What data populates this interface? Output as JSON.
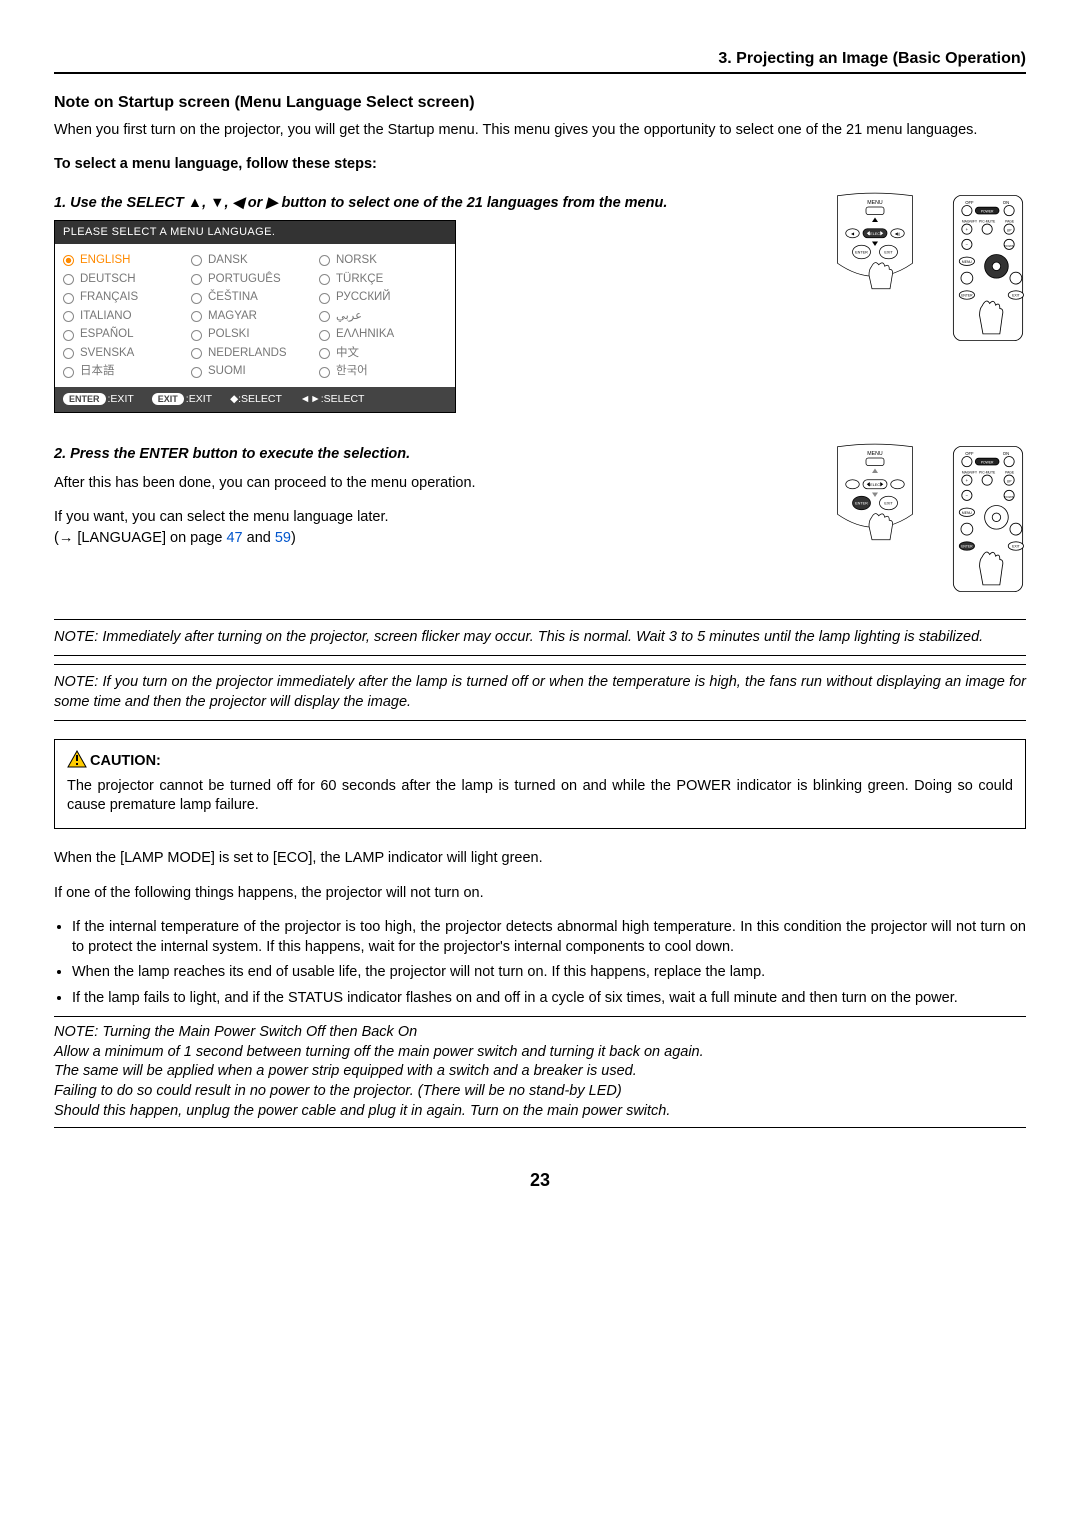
{
  "chapter_header": "3. Projecting an Image (Basic Operation)",
  "section_title": "Note on Startup screen (Menu Language Select screen)",
  "intro": "When you first turn on the projector, you will get the Startup menu. This menu gives you the opportunity to select one of the 21 menu languages.",
  "sub_bold": "To select a menu language, follow these steps:",
  "step1_label": "1.  Use the SELECT ▲, ▼, ◀ or ▶ button to select one of the 21 languages from the menu.",
  "osd": {
    "title": "PLEASE SELECT A MENU LANGUAGE.",
    "cols": [
      [
        "ENGLISH",
        "DEUTSCH",
        "FRANÇAIS",
        "ITALIANO",
        "ESPAÑOL",
        "SVENSKA",
        "日本語"
      ],
      [
        "DANSK",
        "PORTUGUÊS",
        "ČEŠTINA",
        "MAGYAR",
        "POLSKI",
        "NEDERLANDS",
        "SUOMI"
      ],
      [
        "NORSK",
        "TÜRKÇE",
        "РУССКИЙ",
        "عربي",
        "ΕΛΛΗΝΙΚΑ",
        "中文",
        "한국어"
      ]
    ],
    "footer": [
      "ENTER :EXIT",
      "EXIT :EXIT",
      "◆:SELECT",
      "◄►:SELECT"
    ],
    "footer_pills": [
      "ENTER",
      "EXIT"
    ]
  },
  "step2_label": "2.  Press the ENTER button to execute the selection.",
  "after1": "After this has been done, you can proceed to the menu operation.",
  "after2": "If you want, you can select the menu language later.",
  "after3_prefix": "(→ [LANGUAGE] on page ",
  "page_link1": "47",
  "and_word": " and ",
  "page_link2": "59",
  "after3_suffix": ")",
  "note1": "NOTE: Immediately after turning on the projector, screen flicker may occur. This is normal. Wait 3 to 5 minutes until the lamp lighting is stabilized.",
  "note2": "NOTE: If you turn on the projector immediately after the lamp is turned off or when the temperature is high, the fans run without displaying an image for some time and then the projector will display the image.",
  "caution_label": "CAUTION:",
  "caution_text": "The projector cannot be turned off for 60 seconds after the lamp is turned on and while the POWER indicator is blinking green. Doing so could cause premature lamp failure.",
  "eco_text": "When the [LAMP MODE] is set to [ECO], the LAMP indicator will light green.",
  "list_intro": "If one of the following things happens, the projector will not turn on.",
  "bullets": [
    "If the internal temperature of the projector is too high, the projector detects abnormal high temperature. In this condition the projector will not turn on to protect the internal system. If this happens, wait for the projector's internal components to cool down.",
    "When the lamp reaches its end of usable life, the projector will not turn on. If this happens, replace the lamp.",
    "If the lamp fails to light, and if the STATUS indicator flashes on and off in a cycle of six times, wait a full minute and then turn on the power."
  ],
  "note3_lines": [
    "NOTE: Turning the Main Power Switch Off then Back On",
    "Allow a minimum of 1 second between turning off the main power switch and turning it back on again.",
    "The same will be applied when a power strip equipped with a switch and a breaker is used.",
    "Failing to do so could result in no power to the projector. (There will be no stand-by LED)",
    "Should this happen, unplug the power cable and plug it in again. Turn on the main power switch."
  ],
  "page_number": "23",
  "diag_labels": {
    "menu": "MENU",
    "select": "SELECT",
    "enter": "ENTER",
    "exit": "EXIT",
    "off": "OFF",
    "on": "ON",
    "power": "POWER",
    "magnify": "MAGNIFY",
    "picmute": "PIC-MUTE",
    "page": "PAGE",
    "up": "UP",
    "down": "DOWN"
  }
}
